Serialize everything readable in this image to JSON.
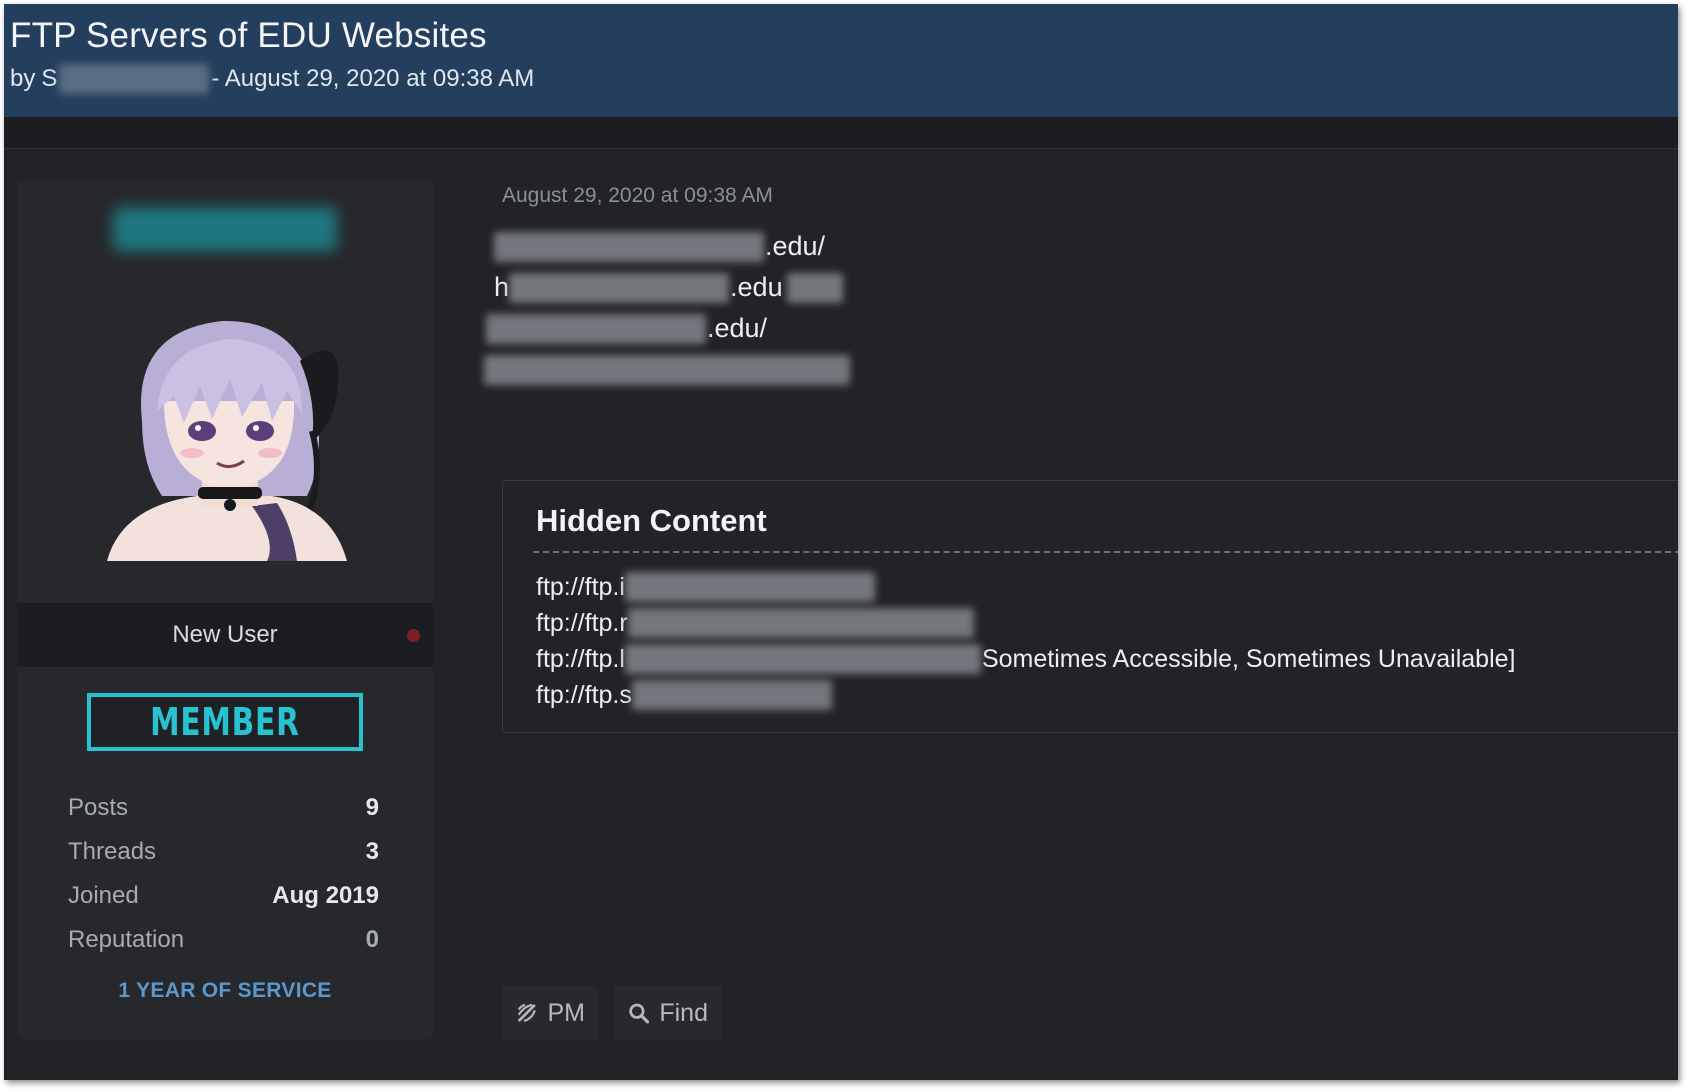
{
  "thread": {
    "title": "FTP Servers of EDU Websites",
    "by_prefix": "by",
    "by_initial": "S",
    "date_suffix": "- August 29, 2020 at 09:38 AM"
  },
  "user": {
    "rank": "New User",
    "badge": "MEMBER",
    "stats": [
      {
        "label": "Posts",
        "value": "9"
      },
      {
        "label": "Threads",
        "value": "3"
      },
      {
        "label": "Joined",
        "value": "Aug 2019"
      },
      {
        "label": "Reputation",
        "value": "0"
      }
    ],
    "service": "1 YEAR OF SERVICE"
  },
  "post": {
    "date": "August 29, 2020 at 09:38 AM",
    "links": [
      {
        "prefix": "",
        "suffix": ".edu/"
      },
      {
        "prefix": "h",
        "suffix": ".edu"
      },
      {
        "prefix": "",
        "suffix": ".edu/"
      },
      {
        "prefix": "",
        "suffix": ""
      }
    ],
    "hidden": {
      "title": "Hidden Content",
      "lines": [
        {
          "prefix": "ftp://ftp.i",
          "suffix": ""
        },
        {
          "prefix": "ftp://ftp.r",
          "suffix": ""
        },
        {
          "prefix": "ftp://ftp.l",
          "suffix": "Sometimes Accessible, Sometimes Unavailable]"
        },
        {
          "prefix": "ftp://ftp.s",
          "suffix": ""
        }
      ]
    }
  },
  "actions": {
    "pm_label": "PM",
    "find_label": "Find"
  },
  "colors": {
    "header": "#243f5d",
    "background": "#222326",
    "accent_teal": "#28c3d1",
    "service_blue": "#5b98cc",
    "status_red": "#7d1f25"
  }
}
